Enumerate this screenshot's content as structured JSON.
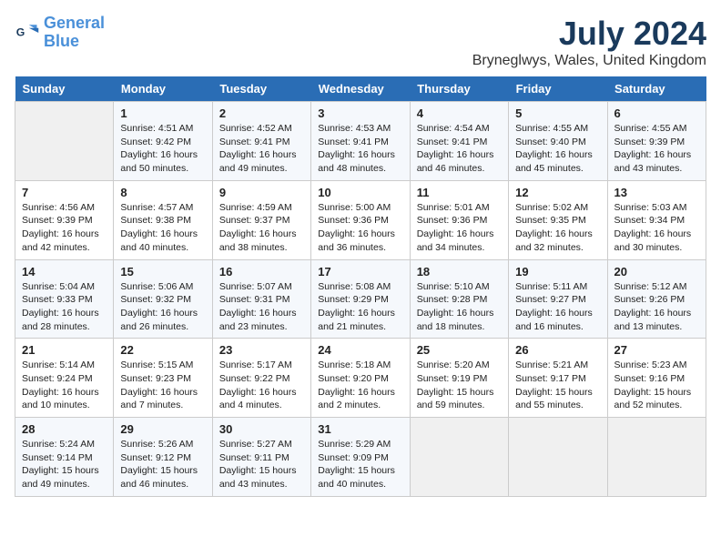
{
  "logo": {
    "text_general": "General",
    "text_blue": "Blue"
  },
  "title": "July 2024",
  "subtitle": "Bryneglwys, Wales, United Kingdom",
  "days_of_week": [
    "Sunday",
    "Monday",
    "Tuesday",
    "Wednesday",
    "Thursday",
    "Friday",
    "Saturday"
  ],
  "weeks": [
    [
      {
        "day": "",
        "info": ""
      },
      {
        "day": "1",
        "info": "Sunrise: 4:51 AM\nSunset: 9:42 PM\nDaylight: 16 hours\nand 50 minutes."
      },
      {
        "day": "2",
        "info": "Sunrise: 4:52 AM\nSunset: 9:41 PM\nDaylight: 16 hours\nand 49 minutes."
      },
      {
        "day": "3",
        "info": "Sunrise: 4:53 AM\nSunset: 9:41 PM\nDaylight: 16 hours\nand 48 minutes."
      },
      {
        "day": "4",
        "info": "Sunrise: 4:54 AM\nSunset: 9:41 PM\nDaylight: 16 hours\nand 46 minutes."
      },
      {
        "day": "5",
        "info": "Sunrise: 4:55 AM\nSunset: 9:40 PM\nDaylight: 16 hours\nand 45 minutes."
      },
      {
        "day": "6",
        "info": "Sunrise: 4:55 AM\nSunset: 9:39 PM\nDaylight: 16 hours\nand 43 minutes."
      }
    ],
    [
      {
        "day": "7",
        "info": "Sunrise: 4:56 AM\nSunset: 9:39 PM\nDaylight: 16 hours\nand 42 minutes."
      },
      {
        "day": "8",
        "info": "Sunrise: 4:57 AM\nSunset: 9:38 PM\nDaylight: 16 hours\nand 40 minutes."
      },
      {
        "day": "9",
        "info": "Sunrise: 4:59 AM\nSunset: 9:37 PM\nDaylight: 16 hours\nand 38 minutes."
      },
      {
        "day": "10",
        "info": "Sunrise: 5:00 AM\nSunset: 9:36 PM\nDaylight: 16 hours\nand 36 minutes."
      },
      {
        "day": "11",
        "info": "Sunrise: 5:01 AM\nSunset: 9:36 PM\nDaylight: 16 hours\nand 34 minutes."
      },
      {
        "day": "12",
        "info": "Sunrise: 5:02 AM\nSunset: 9:35 PM\nDaylight: 16 hours\nand 32 minutes."
      },
      {
        "day": "13",
        "info": "Sunrise: 5:03 AM\nSunset: 9:34 PM\nDaylight: 16 hours\nand 30 minutes."
      }
    ],
    [
      {
        "day": "14",
        "info": "Sunrise: 5:04 AM\nSunset: 9:33 PM\nDaylight: 16 hours\nand 28 minutes."
      },
      {
        "day": "15",
        "info": "Sunrise: 5:06 AM\nSunset: 9:32 PM\nDaylight: 16 hours\nand 26 minutes."
      },
      {
        "day": "16",
        "info": "Sunrise: 5:07 AM\nSunset: 9:31 PM\nDaylight: 16 hours\nand 23 minutes."
      },
      {
        "day": "17",
        "info": "Sunrise: 5:08 AM\nSunset: 9:29 PM\nDaylight: 16 hours\nand 21 minutes."
      },
      {
        "day": "18",
        "info": "Sunrise: 5:10 AM\nSunset: 9:28 PM\nDaylight: 16 hours\nand 18 minutes."
      },
      {
        "day": "19",
        "info": "Sunrise: 5:11 AM\nSunset: 9:27 PM\nDaylight: 16 hours\nand 16 minutes."
      },
      {
        "day": "20",
        "info": "Sunrise: 5:12 AM\nSunset: 9:26 PM\nDaylight: 16 hours\nand 13 minutes."
      }
    ],
    [
      {
        "day": "21",
        "info": "Sunrise: 5:14 AM\nSunset: 9:24 PM\nDaylight: 16 hours\nand 10 minutes."
      },
      {
        "day": "22",
        "info": "Sunrise: 5:15 AM\nSunset: 9:23 PM\nDaylight: 16 hours\nand 7 minutes."
      },
      {
        "day": "23",
        "info": "Sunrise: 5:17 AM\nSunset: 9:22 PM\nDaylight: 16 hours\nand 4 minutes."
      },
      {
        "day": "24",
        "info": "Sunrise: 5:18 AM\nSunset: 9:20 PM\nDaylight: 16 hours\nand 2 minutes."
      },
      {
        "day": "25",
        "info": "Sunrise: 5:20 AM\nSunset: 9:19 PM\nDaylight: 15 hours\nand 59 minutes."
      },
      {
        "day": "26",
        "info": "Sunrise: 5:21 AM\nSunset: 9:17 PM\nDaylight: 15 hours\nand 55 minutes."
      },
      {
        "day": "27",
        "info": "Sunrise: 5:23 AM\nSunset: 9:16 PM\nDaylight: 15 hours\nand 52 minutes."
      }
    ],
    [
      {
        "day": "28",
        "info": "Sunrise: 5:24 AM\nSunset: 9:14 PM\nDaylight: 15 hours\nand 49 minutes."
      },
      {
        "day": "29",
        "info": "Sunrise: 5:26 AM\nSunset: 9:12 PM\nDaylight: 15 hours\nand 46 minutes."
      },
      {
        "day": "30",
        "info": "Sunrise: 5:27 AM\nSunset: 9:11 PM\nDaylight: 15 hours\nand 43 minutes."
      },
      {
        "day": "31",
        "info": "Sunrise: 5:29 AM\nSunset: 9:09 PM\nDaylight: 15 hours\nand 40 minutes."
      },
      {
        "day": "",
        "info": ""
      },
      {
        "day": "",
        "info": ""
      },
      {
        "day": "",
        "info": ""
      }
    ]
  ]
}
